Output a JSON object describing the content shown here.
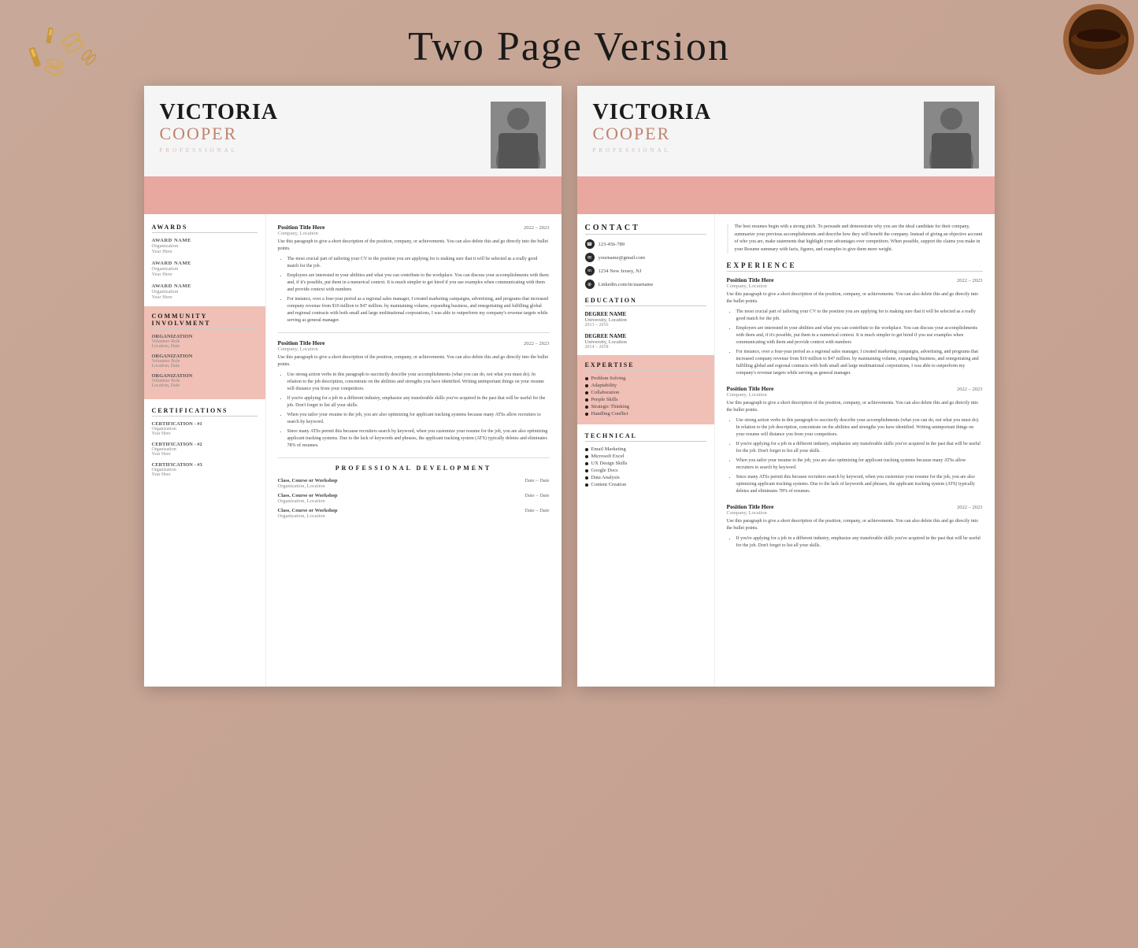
{
  "page": {
    "title": "Two Page Version",
    "background_color": "#c9a99a"
  },
  "resume1": {
    "first_name": "VICTORIA",
    "last_name": "COOPER",
    "professional": "PROFESSIONAL",
    "sections": {
      "awards": {
        "title": "AWARDS",
        "items": [
          {
            "label": "AWARD NAME",
            "org": "Organization",
            "year": "Year Here"
          },
          {
            "label": "AWARD NAME",
            "org": "Organization",
            "year": "Year Here"
          },
          {
            "label": "AWARD NAME",
            "org": "Organization",
            "year": "Year Here"
          }
        ]
      },
      "community": {
        "title": "COMMUNITY INVOLVMENT",
        "items": [
          {
            "label": "ORGANIZATION",
            "role": "Volunteer Role",
            "location_date": "Location, Date"
          },
          {
            "label": "ORGANIZATION",
            "role": "Volunteer Role",
            "location_date": "Location, Date"
          },
          {
            "label": "ORGANIZATION",
            "role": "Volunteer Role",
            "location_date": "Location, Date"
          }
        ]
      },
      "certifications": {
        "title": "CERTIFICATIONS",
        "items": [
          {
            "label": "CERTIFICATION - #1",
            "org": "Organization",
            "year": "Year Here"
          },
          {
            "label": "CERTIFICATION - #2",
            "org": "Organization",
            "year": "Year Here"
          },
          {
            "label": "CERTIFICATION - #3",
            "org": "Organization",
            "year": "Year Here"
          }
        ]
      },
      "experience": {
        "positions": [
          {
            "title": "Position Title Here",
            "company": "Company, Location",
            "date": "2022 – 2023",
            "desc": "Use this paragraph to give a short description of the position, company, or achievements. You can also delete this and go directly into the bullet points.",
            "bullets": [
              "The most crucial part of tailoring your CV to the position you are applying for is making sure that it will be selected as a really good match for the job.",
              "Employers are interested in your abilities and what you can contribute to the workplace. You can discuss your accomplishments with them and, if it's possible, put them in a numerical context. It is much simpler to get hired if you use examples when communicating with them and provide context with numbers",
              "For instance, over a four-year period as a regional sales manager, I created marketing campaigns, advertising, and programs that increased company revenue from $10 million to $47 million. by maintaining volume, expanding business, and renegotiating and fulfilling global and regional contracts with both small and large multinational corporations, I was able to outperform my company's revenue targets while serving as general manager."
            ]
          },
          {
            "title": "Position Title Here",
            "company": "Company, Location",
            "date": "2022 – 2023",
            "desc": "Use this paragraph to give a short description of the position, company, or achievements. You can also delete this and go directly into the bullet points.",
            "bullets": [
              "Use strong action verbs in this paragraph to succinctly describe your accomplishments (what you can do, not what you must do). In relation to the job description, concentrate on the abilities and strengths you have identified. Writing unimportant things on your resume will distance you from your competitors.",
              "If you're applying for a job in a different industry, emphasize any transferable skills you've acquired in the past that will be useful for the job. Don't forget to list all your skills.",
              "When you tailor your resume to the job, you are also optimizing for applicant tracking systems because many ATSs allow recruiters to search by keyword.",
              "Since many ATSs permit this because recruiters search by keyword, when you customize your resume for the job, you are also optimizing applicant tracking systems. Due to the lack of keywords and phrases, the applicant tracking system (ATS) typically deletes and eliminates 78% of resumes."
            ]
          }
        ]
      },
      "professional_development": {
        "title": "PROFESSIONAL DEVELOPMENT",
        "items": [
          {
            "course": "Class, Course or Workshop",
            "org": "Organization, Location",
            "date": "Date – Date"
          },
          {
            "course": "Class, Course or Workshop",
            "org": "Organization, Location",
            "date": "Date – Date"
          },
          {
            "course": "Class, Course or Workshop",
            "org": "Organization, Location",
            "date": "Date – Date"
          }
        ]
      }
    }
  },
  "resume2": {
    "first_name": "VICTORIA",
    "last_name": "COOPER",
    "professional": "PROFESSIONAL",
    "intro_text": "The best resumes begin with a strong pitch. To persuade and demonstrate why you are the ideal candidate for their company, summarize your previous accomplishments and describe how they will benefit the company. Instead of giving an objective account of who you are, make statements that highlight your advantages over competitors. When possible, support the claims you make in your Resume summary with facts, figures, and examples to give them more weight.",
    "sections": {
      "contact": {
        "title": "CONTACT",
        "phone": "123-456-789",
        "email": "yourname@gmail.com",
        "address": "1234 New Jersey, NJ",
        "linkedin": "Linkedin.com/in/usarname"
      },
      "education": {
        "title": "EDUCATION",
        "items": [
          {
            "degree": "DEGREE NAME",
            "school": "University, Location",
            "years": "2013 – 2016"
          },
          {
            "degree": "DEGREE NAME",
            "school": "University, Location",
            "years": "2014 – 2018"
          }
        ]
      },
      "expertise": {
        "title": "EXPERTISE",
        "items": [
          "Problem Solving",
          "Adaptability",
          "Collaboration",
          "People Skills",
          "Strategic Thinking",
          "Handling Conflict"
        ]
      },
      "technical": {
        "title": "TECHNICAL",
        "items": [
          "Email Marketing",
          "Microsoft Excel",
          "UX Design Skills",
          "Google Docs",
          "Data Analysis",
          "Content Creation"
        ]
      },
      "experience": {
        "title": "EXPERIENCE",
        "positions": [
          {
            "title": "Position Title Here",
            "company": "Company, Location",
            "date": "2022 – 2023",
            "desc": "Use this paragraph to give a short description of the position, company, or achievements. You can also delete this and go directly into the bullet points.",
            "bullets": [
              "The most crucial part of tailoring your CV to the position you are applying for is making sure that it will be selected as a really good match for the job.",
              "Employers are interested in your abilities and what you can contribute to the workplace. You can discuss your accomplishments with them and, if it's possible, put them in a numerical context. It is much simpler to get hired if you use examples when communicating with them and provide context with numbers",
              "For instance, over a four-year period as a regional sales manager, I created marketing campaigns, advertising, and programs that increased company revenue from $10 million to $47 million. by maintaining volume, expanding business, and renegotiating and fulfilling global and regional contracts with both small and large multinational corporations, I was able to outperform my company's revenue targets while serving as general manager."
            ]
          },
          {
            "title": "Position Title Here",
            "company": "Company, Location",
            "date": "2022 – 2023",
            "desc": "Use this paragraph to give a short description of the position, company, or achievements. You can also delete this and go directly into the bullet points.",
            "bullets": [
              "Use strong action verbs in this paragraph to succinctly describe your accomplishments (what you can do, not what you must do). In relation to the job description, concentrate on the abilities and strengths you have identified. Writing unimportant things on your resume will distance you from your competitors.",
              "If you're applying for a job in a different industry, emphasize any transferable skills you've acquired in the past that will be useful for the job. Don't forget to list all your skills.",
              "When you tailor your resume to the job, you are also optimizing for applicant tracking systems because many ATSs allow recruiters to search by keyword.",
              "Since many ATSs permit this because recruiters search by keyword, when you customize your resume for the job, you are also optimizing applicant tracking systems. Due to the lack of keywords and phrases, the applicant tracking system (ATS) typically deletes and eliminates 78% of resumes."
            ]
          },
          {
            "title": "Position Title Here",
            "company": "Company, Location",
            "date": "2022 – 2023",
            "desc": "Use this paragraph to give a short description of the position, company, or achievements. You can also delete this and go directly into the bullet points.",
            "bullets": [
              "If you're applying for a job in a different industry, emphasize any transferable skills you've acquired in the past that will be useful for the job. Don't forget to list all your skills."
            ]
          }
        ]
      }
    }
  }
}
